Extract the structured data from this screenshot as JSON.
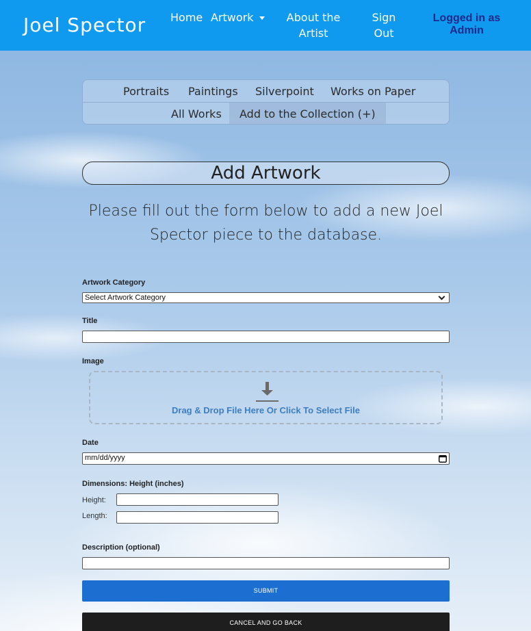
{
  "header": {
    "brand": "Joel Spector",
    "nav": {
      "home": "Home",
      "artwork": "Artwork",
      "about_line1": "About the",
      "about_line2": "Artist",
      "signout_line1": "Sign",
      "signout_line2": "Out"
    },
    "login_line1": "Logged in as",
    "login_line2": "Admin",
    "bar_color": "#0f9af0"
  },
  "subnav": {
    "items": [
      "Portraits",
      "Paintings",
      "Silverpoint",
      "Works on Paper",
      "All Works",
      "Add to the Collection (+)"
    ],
    "active": "Add to the Collection (+)"
  },
  "page": {
    "heading": "Add Artwork",
    "intro": "Please fill out the form below to add a new Joel Spector piece to the database."
  },
  "form": {
    "category_label": "Artwork Category",
    "category_selected": "Select Artwork Category",
    "title_label": "Title",
    "title_value": "",
    "image_label": "Image",
    "dropzone_text": "Drag & Drop File Here Or Click To Select File",
    "date_label": "Date",
    "date_placeholder": "mm/dd/yyyy",
    "dimensions_label": "Dimensions: Height (inches)",
    "height_label": "Height:",
    "length_label": "Length:",
    "height_value": "",
    "length_value": "",
    "description_label": "Description (optional)",
    "description_value": "",
    "submit_label": "SUBMIT",
    "cancel_label": "CANCEL AND GO BACK"
  },
  "colors": {
    "submit": "#1c6fd1",
    "cancel": "#1e1e1e",
    "login_text": "#1a2a8a",
    "dropzone_text": "#3d7ec0"
  },
  "icons": {
    "dropzone": "download-arrow-icon",
    "date": "calendar-icon",
    "select": "chevron-down-icon",
    "artwork_menu": "caret-down-icon"
  }
}
